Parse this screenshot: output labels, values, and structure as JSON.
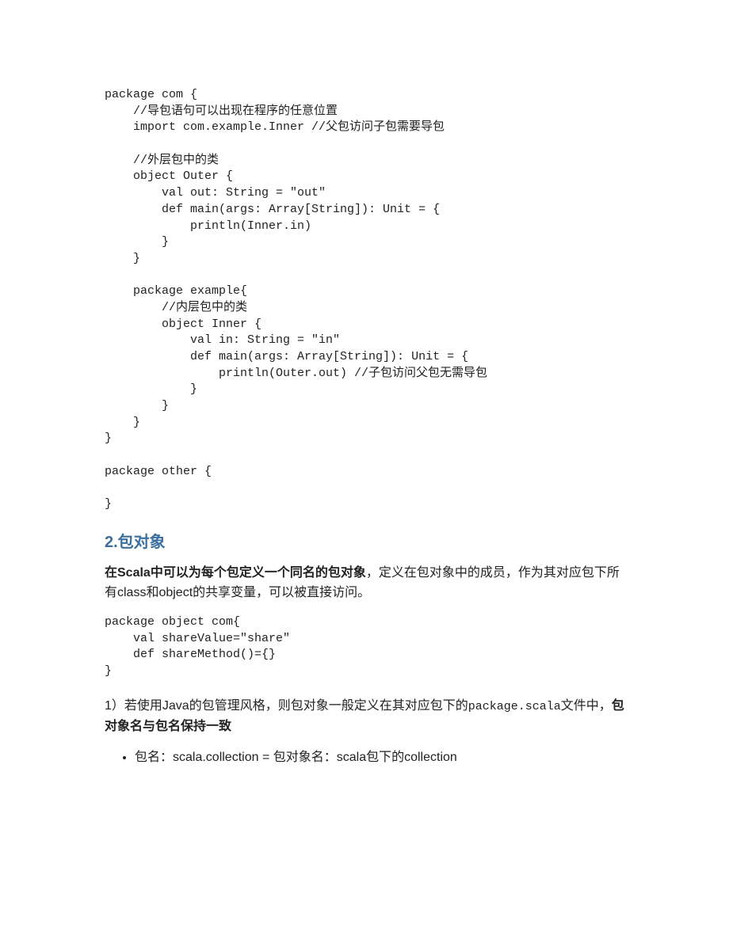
{
  "code_block_1": "package com {\n    //导包语句可以出现在程序的任意位置\n    import com.example.Inner //父包访问子包需要导包\n\n    //外层包中的类\n    object Outer {\n        val out: String = \"out\"\n        def main(args: Array[String]): Unit = {\n            println(Inner.in)\n        }\n    }\n\n    package example{\n        //内层包中的类\n        object Inner {\n            val in: String = \"in\"\n            def main(args: Array[String]): Unit = {\n                println(Outer.out) //子包访问父包无需导包\n            }\n        }\n    }\n}\n\npackage other {\n\n}",
  "section_title": "2.包对象",
  "para1_strong": "在Scala中可以为每个包定义一个同名的包对象",
  "para1_rest": "，定义在包对象中的成员，作为其对应包下所有class和object的共享变量，可以被直接访问。",
  "code_block_2": "package object com{\n    val shareValue=\"share\"\n    def shareMethod()={}\n}",
  "para2_pre": "1）若使用Java的包管理风格，则包对象一般定义在其对应包下的",
  "para2_code": "package.scala",
  "para2_mid": "文件中，",
  "para2_strong": "包对象名与包名保持一致",
  "bullet1": "包名：scala.collection = 包对象名：scala包下的collection"
}
